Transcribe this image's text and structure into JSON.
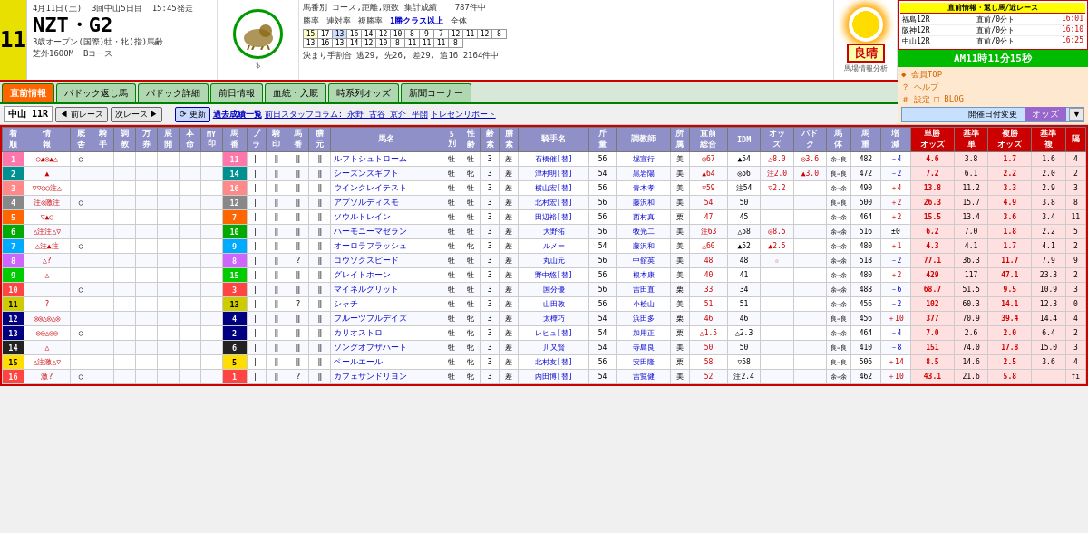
{
  "header": {
    "race_num": "11",
    "race_date": "4月11日(土)",
    "venue": "3回中山5日目",
    "time": "15:45発走",
    "race_name": "NZT・G2",
    "race_class": "3歳オープン(国際)牡・牝(指)馬齢",
    "distance": "芝外1600M",
    "course": "Bコース",
    "weather": "良晴",
    "total_count": "787件中",
    "kessun": "決まり手割合 逃29, 先26, 差29, 追16  2164件中",
    "current_time": "AM11時11分15秒",
    "nav": {
      "member": "会員TOP",
      "help": "ヘルプ",
      "settings": "設定",
      "blog": "BLOG",
      "open_date_change": "開催日付変更"
    },
    "live_info": {
      "title": "直前情報・返し馬/近レース",
      "rows": [
        {
          "place": "福島12R",
          "type": "直前/0分ト",
          "time": "16:01"
        },
        {
          "place": "阪神12R",
          "type": "直前/0分ト",
          "time": "16:10"
        },
        {
          "place": "中山12R",
          "type": "直前/0分ト",
          "time": "16:25"
        }
      ]
    },
    "stats": {
      "label1": "馬番別 コース,距離,頭数 集計成績",
      "col_headers": [
        "勝率",
        "連対率",
        "複勝率",
        "1勝クラス以上",
        "全体"
      ],
      "rows": [
        [
          "15",
          "17",
          "13",
          "16",
          "14",
          "12",
          "10",
          "8",
          "9",
          "7",
          "12",
          "11",
          "12",
          "8"
        ],
        [
          "13",
          "16",
          "13",
          "14",
          "12",
          "10",
          "8",
          "11",
          "11",
          "11",
          "8"
        ]
      ]
    }
  },
  "tabs": [
    {
      "label": "直前情報",
      "active": true
    },
    {
      "label": "パドック返し馬",
      "active": false
    },
    {
      "label": "パドック詳細",
      "active": false
    },
    {
      "label": "前日情報",
      "active": false
    },
    {
      "label": "血統・入厩",
      "active": false
    },
    {
      "label": "時系列オッズ",
      "active": false
    },
    {
      "label": "新聞コーナー",
      "active": false
    }
  ],
  "sub_nav": {
    "race_label": "中山 11R",
    "prev_race": "前レース",
    "next_race": "次レース",
    "update": "更新",
    "history_link": "過去成績一覧",
    "staff_link": "前日スタッフコラム: 永野 古谷 京介 平開",
    "report_link": "トレセンリポート",
    "odds_label": "オッズ"
  },
  "table": {
    "col_headers": [
      "着",
      "情報",
      "厩",
      "騎",
      "調",
      "万",
      "展",
      "本",
      "MY",
      "馬",
      "ブ",
      "騎",
      "馬",
      "膳",
      "馬名",
      "5",
      "性",
      "齢",
      "膳",
      "騎手名",
      "斤量",
      "調教師",
      "所",
      "直前",
      "IDM",
      "オッ",
      "パド",
      "馬",
      "馬",
      "増減",
      "単勝",
      "基準",
      "複勝",
      "基準",
      "隔"
    ],
    "col_headers2": [
      "順",
      "報",
      "舎",
      "手",
      "教",
      "券",
      "開",
      "命",
      "印",
      "番",
      "ラ",
      "印",
      "番",
      "元",
      "",
      "別",
      "齢",
      "素",
      "手名",
      "量",
      "師",
      "属",
      "総合",
      "",
      "ズ",
      "ク",
      "体",
      "重",
      "",
      "オッズ",
      "単",
      "オッズ",
      "複",
      ""
    ],
    "rows": [
      {
        "rank": "1",
        "rank_class": "rn-11",
        "info_marks": "○▲◎▲△",
        "circle": "○",
        "tri": "▲",
        "dtri": "△",
        "frame_num": "11",
        "horse_num": "11",
        "horse_name": "ルフトシュトローム",
        "sex": "牡",
        "age": "3",
        "jockey": "石橋催[替]",
        "weight_carry": "56",
        "trainer": "堀宣行",
        "belong": "美",
        "chokuson": "◎67",
        "idm": "▲54",
        "odds": "△8.0",
        "pado": "◎3.6",
        "track_cond": "余→良",
        "horse_weight": "482",
        "weight_change": "－4",
        "tansho": "4.6",
        "kijun_tan": "3.8",
        "fukusho": "1.7",
        "kijun_fuku": "1.6",
        "gap": "4"
      },
      {
        "rank": "2",
        "rank_class": "rn-14",
        "info_marks": "▲",
        "circle": "",
        "tri": "▲",
        "dtri": "",
        "frame_num": "14",
        "horse_num": "14",
        "horse_name": "シーズンズギフト",
        "sex": "牝",
        "age": "3",
        "jockey": "津村明[替]",
        "weight_carry": "54",
        "trainer": "黒岩陽",
        "belong": "美",
        "chokuson": "▲64",
        "idm": "◎56",
        "odds": "注2.0",
        "pado": "▲3.0",
        "track_cond": "良→良",
        "horse_weight": "472",
        "weight_change": "－2",
        "tansho": "7.2",
        "kijun_tan": "6.1",
        "fukusho": "2.2",
        "kijun_fuku": "2.0",
        "gap": "2"
      },
      {
        "rank": "3",
        "rank_class": "rn-16",
        "info_marks": "▽▽○○注△",
        "circle": "▽",
        "tri": "▽",
        "dtri": "",
        "frame_num": "16",
        "horse_num": "16",
        "horse_name": "ウインクレイテスト",
        "sex": "牡",
        "age": "3",
        "jockey": "横山宏[替]",
        "weight_carry": "56",
        "trainer": "青木孝",
        "belong": "美",
        "chokuson": "▽59",
        "idm": "注54",
        "odds": "▽2.2",
        "pado": "",
        "track_cond": "余→余",
        "horse_weight": "490",
        "weight_change": "＋4",
        "tansho": "13.8",
        "kijun_tan": "11.2",
        "fukusho": "3.3",
        "kijun_fuku": "2.9",
        "gap": "3"
      },
      {
        "rank": "4",
        "rank_class": "rn-12",
        "info_marks": "注◎激注",
        "circle": "",
        "tri": "",
        "dtri": "",
        "frame_num": "12",
        "horse_num": "12",
        "horse_name": "アプソルディスモ",
        "sex": "牡",
        "age": "3",
        "jockey": "北村宏[替]",
        "weight_carry": "56",
        "trainer": "藤沢和",
        "belong": "美",
        "chokuson": "54",
        "idm": "50",
        "odds": "",
        "pado": "",
        "track_cond": "良→良",
        "horse_weight": "500",
        "weight_change": "＋2",
        "tansho": "26.3",
        "kijun_tan": "15.7",
        "fukusho": "4.9",
        "kijun_fuku": "3.8",
        "gap": "8"
      },
      {
        "rank": "5",
        "rank_class": "rn-7",
        "info_marks": "▽▲○",
        "circle": "",
        "tri": "▽",
        "dtri": "▲",
        "frame_num": "7",
        "horse_num": "7",
        "horse_name": "ソウルトレイン",
        "sex": "牡",
        "age": "3",
        "jockey": "田辺裕[替]",
        "weight_carry": "56",
        "trainer": "西村真",
        "belong": "栗",
        "chokuson": "47",
        "idm": "45",
        "odds": "",
        "pado": "",
        "track_cond": "余→余",
        "horse_weight": "464",
        "weight_change": "＋2",
        "tansho": "15.5",
        "kijun_tan": "13.4",
        "fukusho": "3.6",
        "kijun_fuku": "3.4",
        "gap": "11"
      },
      {
        "rank": "6",
        "rank_class": "rn-10",
        "info_marks": "△注注△▽",
        "circle": "△",
        "tri": "注",
        "dtri": "△",
        "frame_num": "10",
        "horse_num": "10",
        "horse_name": "ハーモニーマゼラン",
        "sex": "牡",
        "age": "3",
        "jockey": "大野拓",
        "weight_carry": "56",
        "trainer": "牧光二",
        "belong": "美",
        "chokuson": "注63",
        "idm": "△58",
        "odds": "◎8.5",
        "pado": "",
        "track_cond": "余→余",
        "horse_weight": "516",
        "weight_change": "±0",
        "tansho": "6.2",
        "kijun_tan": "7.0",
        "fukusho": "1.8",
        "kijun_fuku": "2.2",
        "gap": "5"
      },
      {
        "rank": "7",
        "rank_class": "rn-9",
        "info_marks": "△注▲注",
        "circle": "△",
        "tri": "注",
        "dtri": "▲",
        "frame_num": "9",
        "horse_num": "9",
        "horse_name": "オーロラフラッシュ",
        "sex": "牝",
        "age": "3",
        "jockey": "ルメー",
        "weight_carry": "54",
        "trainer": "藤沢和",
        "belong": "美",
        "chokuson": "△60",
        "idm": "▲52",
        "odds": "▲2.5",
        "pado": "",
        "track_cond": "余→余",
        "horse_weight": "480",
        "weight_change": "＋1",
        "tansho": "4.3",
        "kijun_tan": "4.1",
        "fukusho": "1.7",
        "kijun_fuku": "4.1",
        "gap": "2"
      },
      {
        "rank": "8",
        "rank_class": "rn-8",
        "info_marks": "△?",
        "circle": "",
        "tri": "△",
        "dtri": "",
        "frame_num": "8",
        "horse_num": "8",
        "horse_name": "コウソクスピード",
        "sex": "牡",
        "age": "3",
        "jockey": "丸山元",
        "weight_carry": "56",
        "trainer": "中舘英",
        "belong": "美",
        "chokuson": "48",
        "idm": "48",
        "odds": "☆",
        "pado": "",
        "track_cond": "余→余",
        "horse_weight": "518",
        "weight_change": "－2",
        "tansho": "77.1",
        "kijun_tan": "36.3",
        "fukusho": "11.7",
        "kijun_fuku": "7.9",
        "gap": "9"
      },
      {
        "rank": "9",
        "rank_class": "rn-15",
        "info_marks": "△",
        "circle": "",
        "tri": "△",
        "dtri": "",
        "frame_num": "15",
        "horse_num": "15",
        "horse_name": "グレイトホーン",
        "sex": "牡",
        "age": "3",
        "jockey": "野中悠[替]",
        "weight_carry": "56",
        "trainer": "根本康",
        "belong": "美",
        "chokuson": "40",
        "idm": "41",
        "odds": "",
        "pado": "",
        "track_cond": "余→余",
        "horse_weight": "480",
        "weight_change": "＋2",
        "tansho": "429",
        "kijun_tan": "117",
        "fukusho": "47.1",
        "kijun_fuku": "23.3",
        "gap": "2"
      },
      {
        "rank": "10",
        "rank_class": "rn-3",
        "info_marks": "",
        "circle": "",
        "tri": "",
        "dtri": "",
        "frame_num": "3",
        "horse_num": "3",
        "horse_name": "マイネルグリット",
        "sex": "牡",
        "age": "3",
        "jockey": "国分優",
        "weight_carry": "56",
        "trainer": "吉田直",
        "belong": "栗",
        "chokuson": "33",
        "idm": "34",
        "odds": "",
        "pado": "",
        "track_cond": "余→余",
        "horse_weight": "488",
        "weight_change": "－6",
        "tansho": "68.7",
        "kijun_tan": "51.5",
        "fukusho": "9.5",
        "kijun_fuku": "10.9",
        "gap": "3"
      },
      {
        "rank": "11",
        "rank_class": "rn-13",
        "info_marks": "?",
        "circle": "",
        "tri": "",
        "dtri": "",
        "frame_num": "13",
        "horse_num": "13",
        "horse_name": "シャチ",
        "sex": "牡",
        "age": "3",
        "jockey": "山田敦",
        "weight_carry": "56",
        "trainer": "小桧山",
        "belong": "美",
        "chokuson": "51",
        "idm": "51",
        "odds": "",
        "pado": "",
        "track_cond": "余→余",
        "horse_weight": "456",
        "weight_change": "－2",
        "tansho": "102",
        "kijun_tan": "60.3",
        "fukusho": "14.1",
        "kijun_fuku": "12.3",
        "gap": "0"
      },
      {
        "rank": "12",
        "rank_class": "rn-4",
        "info_marks": "◎◎△◎△◎",
        "circle": "◎",
        "tri": "◎",
        "dtri": "△",
        "frame_num": "4",
        "horse_num": "4",
        "horse_name": "フルーツフルデイズ",
        "sex": "牝",
        "age": "3",
        "jockey": "太樺巧",
        "weight_carry": "54",
        "trainer": "浜田多",
        "belong": "栗",
        "chokuson": "46",
        "idm": "46",
        "odds": "",
        "pado": "",
        "track_cond": "良→良",
        "horse_weight": "456",
        "weight_change": "＋10",
        "tansho": "377",
        "kijun_tan": "70.9",
        "fukusho": "39.4",
        "kijun_fuku": "14.4",
        "gap": "4"
      },
      {
        "rank": "13",
        "rank_class": "rn-2",
        "info_marks": "◎◎△◎◎",
        "circle": "◎",
        "tri": "◎",
        "dtri": "",
        "frame_num": "2",
        "horse_num": "2",
        "horse_name": "カリオストロ",
        "sex": "牝",
        "age": "3",
        "jockey": "レヒュ[替]",
        "weight_carry": "54",
        "trainer": "加用正",
        "belong": "栗",
        "chokuson": "△1.5",
        "idm": "△2.3",
        "odds": "",
        "pado": "",
        "track_cond": "余→余",
        "horse_weight": "464",
        "weight_change": "－4",
        "tansho": "7.0",
        "kijun_tan": "2.6",
        "fukusho": "2.0",
        "kijun_fuku": "6.4",
        "gap": "2"
      },
      {
        "rank": "14",
        "rank_class": "rn-6",
        "info_marks": "△",
        "circle": "",
        "tri": "△",
        "dtri": "",
        "frame_num": "6",
        "horse_num": "6",
        "horse_name": "ソングオブザハート",
        "sex": "牝",
        "age": "3",
        "jockey": "川又賢",
        "weight_carry": "54",
        "trainer": "寺島良",
        "belong": "美",
        "chokuson": "50",
        "idm": "50",
        "odds": "",
        "pado": "",
        "track_cond": "良→良",
        "horse_weight": "410",
        "weight_change": "－8",
        "tansho": "151",
        "kijun_tan": "74.0",
        "fukusho": "17.8",
        "kijun_fuku": "15.0",
        "gap": "3"
      },
      {
        "rank": "15",
        "rank_class": "rn-5",
        "info_marks": "△注激△▽",
        "circle": "△",
        "tri": "注",
        "dtri": "激",
        "frame_num": "5",
        "horse_num": "5",
        "horse_name": "ペールエール",
        "sex": "牝",
        "age": "3",
        "jockey": "北村友[替]",
        "weight_carry": "56",
        "trainer": "安田隆",
        "belong": "栗",
        "chokuson": "58",
        "idm": "▽58",
        "odds": "",
        "pado": "",
        "track_cond": "良→良",
        "horse_weight": "506",
        "weight_change": "＋14",
        "tansho": "8.5",
        "kijun_tan": "14.6",
        "fukusho": "2.5",
        "kijun_fuku": "3.6",
        "gap": "4"
      },
      {
        "rank": "16",
        "rank_class": "rn-1",
        "info_marks": "激?",
        "circle": "",
        "tri": "激",
        "dtri": "?",
        "frame_num": "1",
        "horse_num": "1",
        "horse_name": "カフェサンドリヨン",
        "sex": "牝",
        "age": "3",
        "jockey": "内田博[替]",
        "weight_carry": "54",
        "trainer": "吉覧健",
        "belong": "美",
        "chokuson": "52",
        "idm": "注2.4",
        "odds": "",
        "pado": "",
        "track_cond": "余→余",
        "horse_weight": "462",
        "weight_change": "＋10",
        "tansho": "43.1",
        "kijun_tan": "21.6",
        "fukusho": "5.8",
        "kijun_fuku": "",
        "gap": "fi"
      }
    ]
  }
}
